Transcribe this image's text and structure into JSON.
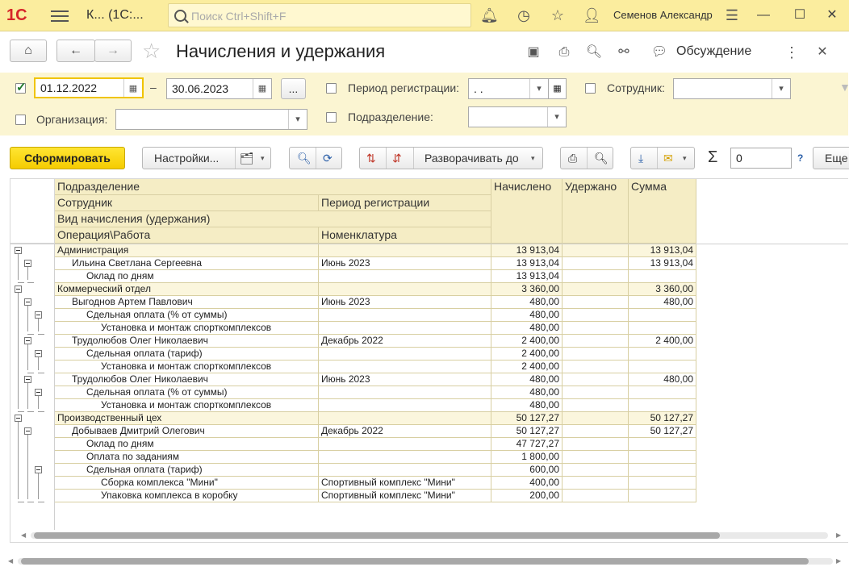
{
  "topbar": {
    "logo": "1С",
    "app_title": "К...  (1С:...",
    "search_placeholder": "Поиск Ctrl+Shift+F",
    "user_name": "Семенов Александр"
  },
  "form": {
    "title": "Начисления и удержания",
    "discuss_label": "Обсуждение"
  },
  "filters": {
    "period_from": "01.12.2022",
    "period_dash": "–",
    "period_to": "30.06.2023",
    "period_more": "...",
    "organization_label": "Организация:",
    "reg_period_label": "Период регистрации:",
    "reg_period_value": " .  .",
    "department_label": "Подразделение:",
    "employee_label": "Сотрудник:"
  },
  "toolbar": {
    "generate_label": "Сформировать",
    "settings_label": "Настройки...",
    "expand_label": "Разворачивать до",
    "sum_value": "0",
    "help_label": "?",
    "more_label": "Еще"
  },
  "report": {
    "headers": {
      "department": "Подразделение",
      "employee": "Сотрудник",
      "reg_period": "Период регистрации",
      "accrual_type": "Вид начисления (удержания)",
      "operation": "Операция\\Работа",
      "nomenclature": "Номенклатура",
      "accrued": "Начислено",
      "withheld": "Удержано",
      "sum": "Сумма"
    },
    "rows": [
      {
        "level": 0,
        "name": "Администрация",
        "period": "",
        "accrued": "13 913,04",
        "withheld": "",
        "sum": "13 913,04"
      },
      {
        "level": 1,
        "name": "Ильина Светлана Сергеевна",
        "period": "Июнь 2023",
        "accrued": "13 913,04",
        "withheld": "",
        "sum": "13 913,04"
      },
      {
        "level": 2,
        "name": "Оклад по дням",
        "period": "",
        "accrued": "13 913,04",
        "withheld": "",
        "sum": ""
      },
      {
        "level": 0,
        "name": "Коммерческий отдел",
        "period": "",
        "accrued": "3 360,00",
        "withheld": "",
        "sum": "3 360,00"
      },
      {
        "level": 1,
        "name": "Выгоднов Артем Павлович",
        "period": "Июнь 2023",
        "accrued": "480,00",
        "withheld": "",
        "sum": "480,00"
      },
      {
        "level": 2,
        "name": "Сдельная оплата (% от суммы)",
        "period": "",
        "accrued": "480,00",
        "withheld": "",
        "sum": ""
      },
      {
        "level": 3,
        "name": "Установка и монтаж спорткомплексов",
        "period": "",
        "accrued": "480,00",
        "withheld": "",
        "sum": ""
      },
      {
        "level": 1,
        "name": "Трудолюбов Олег Николаевич",
        "period": "Декабрь 2022",
        "accrued": "2 400,00",
        "withheld": "",
        "sum": "2 400,00"
      },
      {
        "level": 2,
        "name": "Сдельная оплата (тариф)",
        "period": "",
        "accrued": "2 400,00",
        "withheld": "",
        "sum": ""
      },
      {
        "level": 3,
        "name": "Установка и монтаж спорткомплексов",
        "period": "",
        "accrued": "2 400,00",
        "withheld": "",
        "sum": ""
      },
      {
        "level": 1,
        "name": "Трудолюбов Олег Николаевич",
        "period": "Июнь 2023",
        "accrued": "480,00",
        "withheld": "",
        "sum": "480,00"
      },
      {
        "level": 2,
        "name": "Сдельная оплата (% от суммы)",
        "period": "",
        "accrued": "480,00",
        "withheld": "",
        "sum": ""
      },
      {
        "level": 3,
        "name": "Установка и монтаж спорткомплексов",
        "period": "",
        "accrued": "480,00",
        "withheld": "",
        "sum": ""
      },
      {
        "level": 0,
        "name": "Производственный цех",
        "period": "",
        "accrued": "50 127,27",
        "withheld": "",
        "sum": "50 127,27"
      },
      {
        "level": 1,
        "name": "Добываев Дмитрий Олегович",
        "period": "Декабрь 2022",
        "accrued": "50 127,27",
        "withheld": "",
        "sum": "50 127,27"
      },
      {
        "level": 2,
        "name": "Оклад по дням",
        "period": "",
        "accrued": "47 727,27",
        "withheld": "",
        "sum": ""
      },
      {
        "level": 2,
        "name": "Оплата по заданиям",
        "period": "",
        "accrued": "1 800,00",
        "withheld": "",
        "sum": ""
      },
      {
        "level": 2,
        "name": "Сдельная оплата (тариф)",
        "period": "",
        "accrued": "600,00",
        "withheld": "",
        "sum": ""
      },
      {
        "level": 3,
        "name": "Сборка комплекса \"Мини\"",
        "period": "Спортивный комплекс \"Мини\"",
        "accrued": "400,00",
        "withheld": "",
        "sum": ""
      },
      {
        "level": 3,
        "name": "Упаковка комплекса в коробку",
        "period": "Спортивный комплекс \"Мини\"",
        "accrued": "200,00",
        "withheld": "",
        "sum": ""
      }
    ]
  },
  "colors": {
    "topbar_bg": "#fbed9e",
    "filter_bg": "#fbf5d2",
    "header_bg": "#f5edc5",
    "primary_button": "#f5cc00",
    "logo_red": "#d6262a"
  }
}
